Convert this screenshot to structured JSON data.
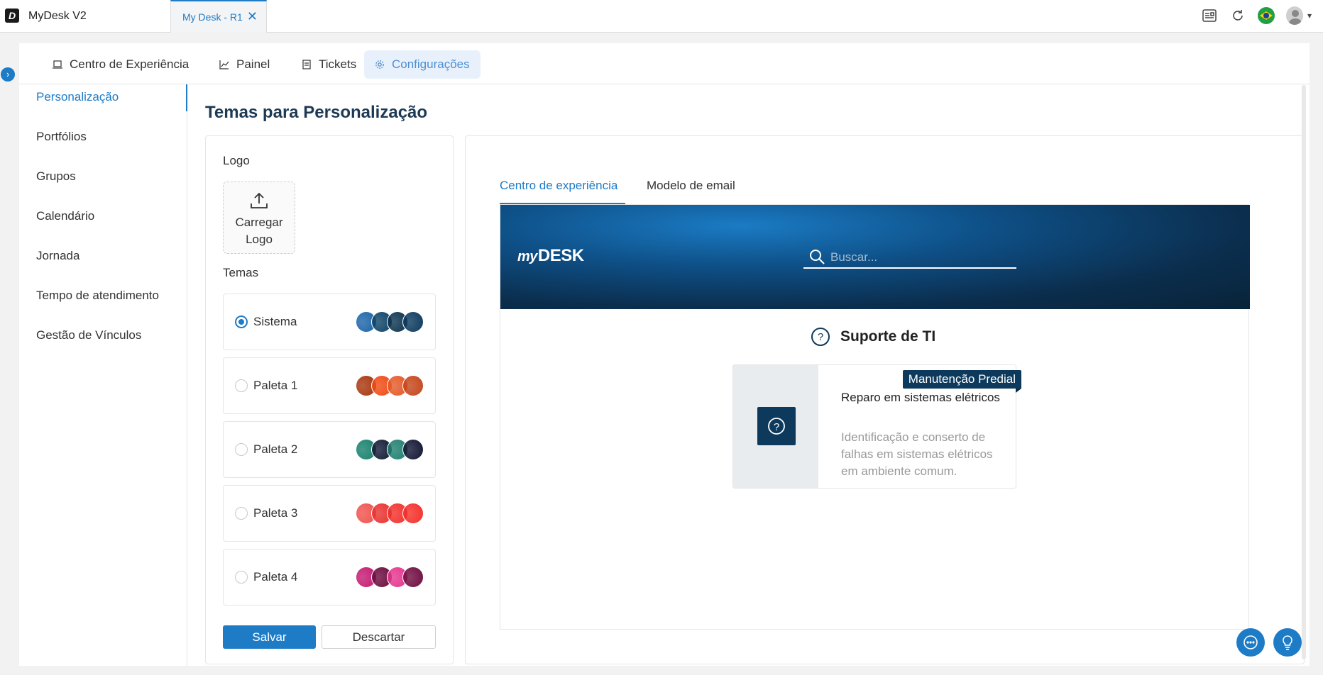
{
  "window": {
    "app_title": "MyDesk V2",
    "tab_label": "My Desk - R1",
    "tab_close": "✕"
  },
  "topnav": {
    "items": [
      {
        "label": "Centro de Experiência",
        "icon": "laptop-icon"
      },
      {
        "label": "Painel",
        "icon": "chart-icon"
      },
      {
        "label": "Tickets",
        "icon": "document-icon"
      },
      {
        "label": "Configurações",
        "icon": "gear-icon",
        "active": true
      }
    ]
  },
  "sidebar": {
    "items": [
      {
        "label": "Personalização",
        "active": true
      },
      {
        "label": "Portfólios"
      },
      {
        "label": "Grupos"
      },
      {
        "label": "Calendário"
      },
      {
        "label": "Jornada"
      },
      {
        "label": "Tempo de atendimento"
      },
      {
        "label": "Gestão de Vínculos"
      }
    ]
  },
  "page": {
    "title": "Temas para Personalização"
  },
  "left_panel": {
    "logo_label": "Logo",
    "upload_line1": "Carregar",
    "upload_line2": "Logo",
    "themes_label": "Temas",
    "themes": [
      {
        "name": "Sistema",
        "selected": true,
        "colors": [
          "#1b64a8",
          "#0e4468",
          "#0d3450",
          "#0c3a5e"
        ]
      },
      {
        "name": "Paleta 1",
        "selected": false,
        "colors": [
          "#a8360e",
          "#f04b14",
          "#e55a28",
          "#c4461b"
        ]
      },
      {
        "name": "Paleta 2",
        "selected": false,
        "colors": [
          "#16806c",
          "#121a36",
          "#1f7f70",
          "#121634"
        ]
      },
      {
        "name": "Paleta 3",
        "selected": false,
        "colors": [
          "#f0524d",
          "#e8332f",
          "#f2302c",
          "#f52f2a"
        ]
      },
      {
        "name": "Paleta 4",
        "selected": false,
        "colors": [
          "#c41a72",
          "#6b0c3e",
          "#e5358f",
          "#6f0d40"
        ]
      }
    ],
    "save_label": "Salvar",
    "discard_label": "Descartar"
  },
  "preview": {
    "tabs": [
      {
        "label": "Centro de experiência",
        "active": true
      },
      {
        "label": "Modelo de email"
      }
    ],
    "brand_my": "my",
    "brand_desk": "DESK",
    "search_placeholder": "Buscar...",
    "section_title": "Suporte de TI",
    "card": {
      "badge": "Manutenção Predial",
      "title": "Reparo em sistemas elétricos",
      "description": "Identificação e conserto de falhas em sistemas elétricos em ambiente comum."
    }
  },
  "colors": {
    "accent": "#1e7bc6",
    "banner_dark": "#082338",
    "card_icon_bg": "#0d3a5c"
  }
}
